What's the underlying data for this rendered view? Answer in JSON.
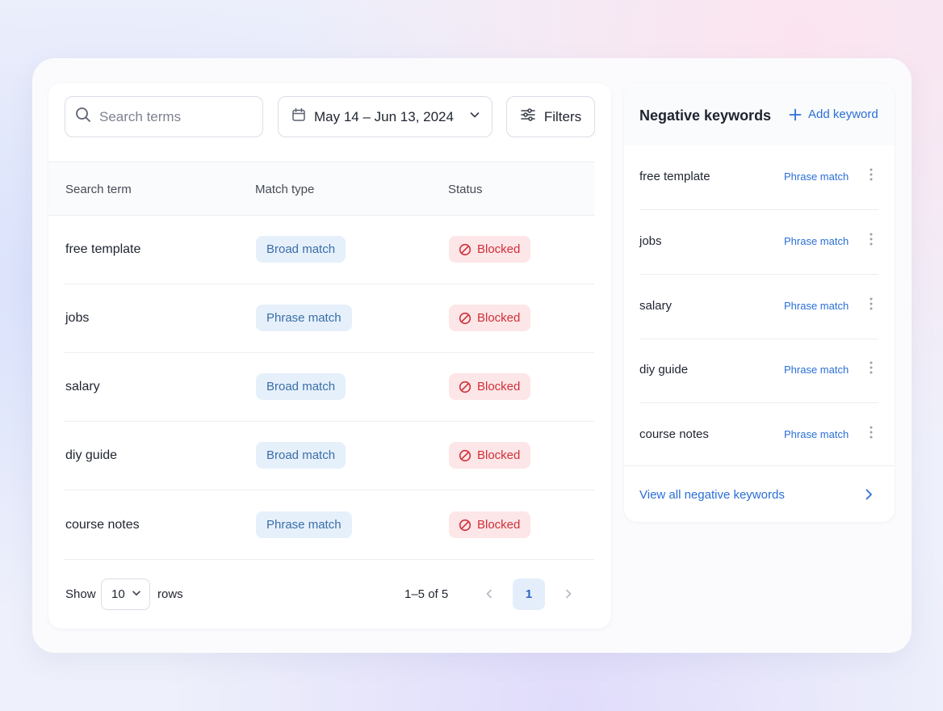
{
  "toolbar": {
    "search_placeholder": "Search terms",
    "date_range": "May 14 – Jun 13, 2024",
    "filters_label": "Filters"
  },
  "table": {
    "columns": [
      "Search term",
      "Match type",
      "Status"
    ],
    "rows": [
      {
        "term": "free template",
        "match": "Broad match",
        "status": "Blocked"
      },
      {
        "term": "jobs",
        "match": "Phrase match",
        "status": "Blocked"
      },
      {
        "term": "salary",
        "match": "Broad match",
        "status": "Blocked"
      },
      {
        "term": "diy guide",
        "match": "Broad match",
        "status": "Blocked"
      },
      {
        "term": "course notes",
        "match": "Phrase match",
        "status": "Blocked"
      }
    ]
  },
  "pagination": {
    "show_label": "Show",
    "rows_per_page": "10",
    "rows_label": "rows",
    "range_text": "1–5 of 5",
    "current_page": "1"
  },
  "negative_keywords": {
    "title": "Negative keywords",
    "add_label": "Add keyword",
    "items": [
      {
        "keyword": "free template",
        "match": "Phrase match"
      },
      {
        "keyword": "jobs",
        "match": "Phrase match"
      },
      {
        "keyword": "salary",
        "match": "Phrase match"
      },
      {
        "keyword": "diy guide",
        "match": "Phrase match"
      },
      {
        "keyword": "course notes",
        "match": "Phrase match"
      }
    ],
    "view_all_label": "View all negative keywords"
  },
  "colors": {
    "accent": "#2a6fd6",
    "blocked": "#d0303a",
    "blocked_bg": "#fde6e7",
    "match_bg": "#e6f0fb"
  },
  "icons": {
    "search": "search-icon",
    "calendar": "calendar-icon",
    "chevron": "chevron-down-icon",
    "filters": "sliders-icon",
    "blocked": "blocked-icon",
    "add": "plus-icon",
    "menu": "more-vertical-icon"
  }
}
